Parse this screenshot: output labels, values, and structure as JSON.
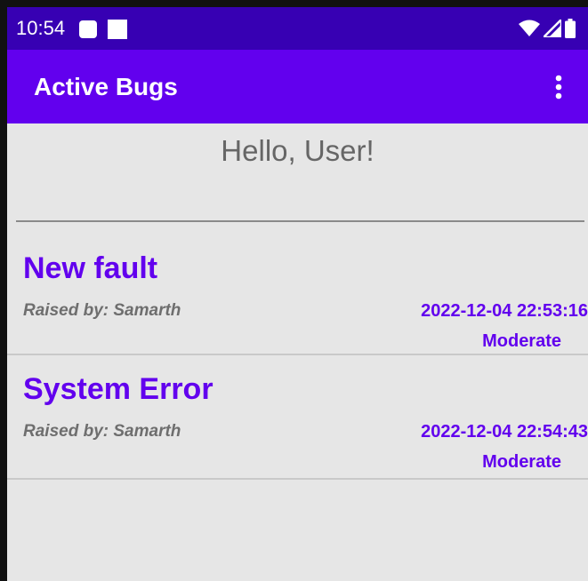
{
  "status_bar": {
    "time": "10:54",
    "icons": [
      "notification-square-icon",
      "notification-square-icon",
      "wifi-icon",
      "signal-icon",
      "battery-icon"
    ]
  },
  "app_bar": {
    "title": "Active Bugs",
    "menu_icon": "more-vert-icon"
  },
  "greeting": "Hello, User!",
  "bugs": [
    {
      "title": "New fault",
      "raised_by": "Raised by: Samarth",
      "timestamp": "2022-12-04 22:53:16",
      "severity": "Moderate"
    },
    {
      "title": "System Error",
      "raised_by": "Raised by: Samarth",
      "timestamp": "2022-12-04 22:54:43",
      "severity": "Moderate"
    }
  ],
  "colors": {
    "status_bar": "#3700b3",
    "app_bar": "#6200ee",
    "accent": "#6200ee",
    "background": "#e6e6e6"
  }
}
